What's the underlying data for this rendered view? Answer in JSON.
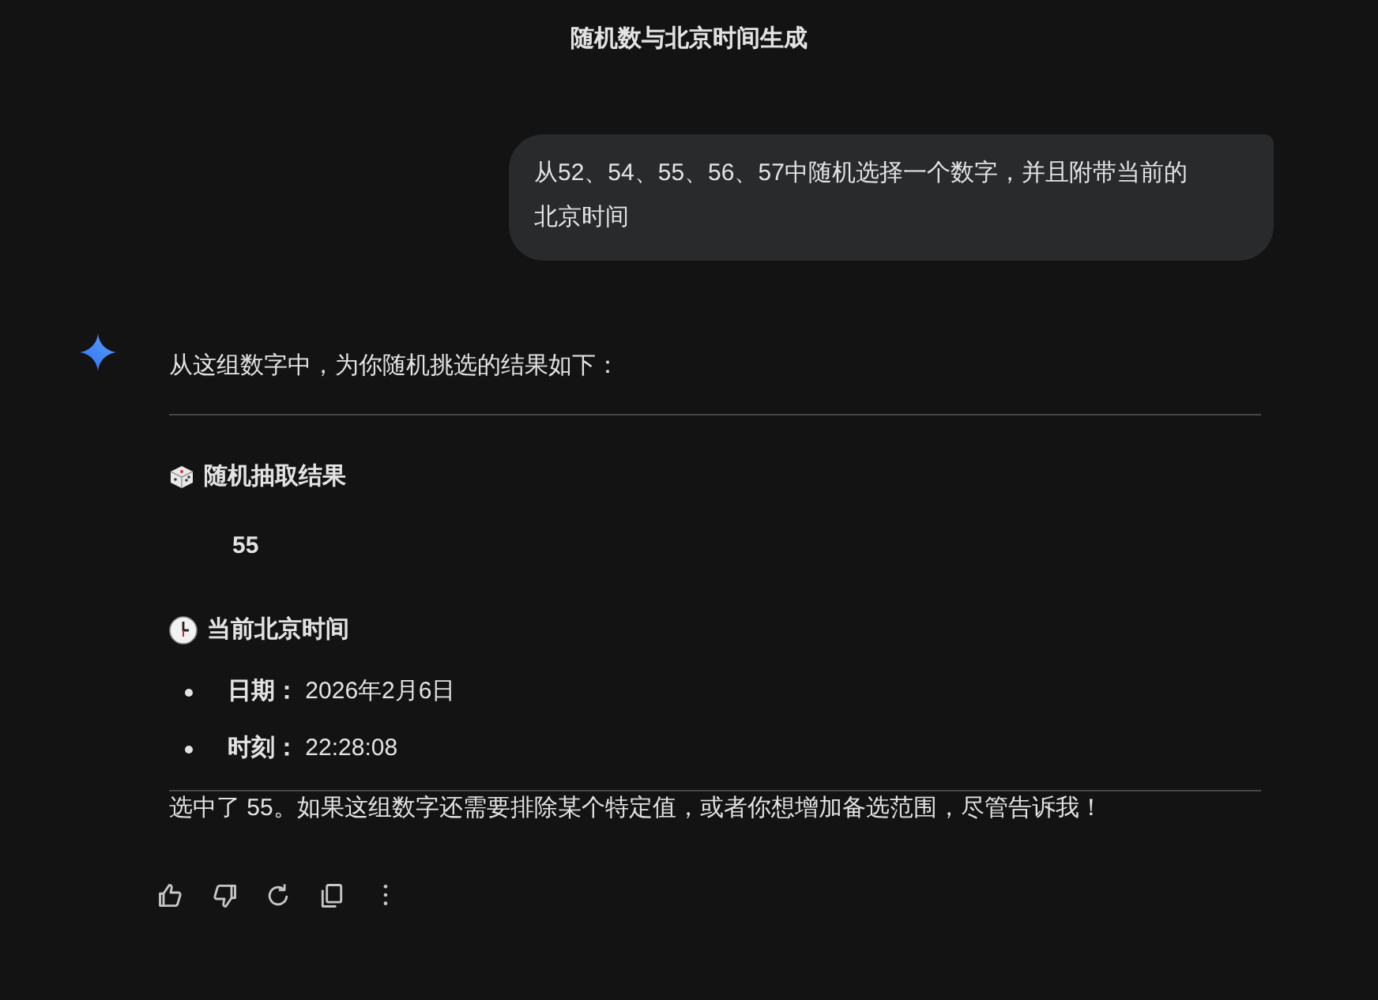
{
  "title": "随机数与北京时间生成",
  "user_message": "从52、54、55、56、57中随机选择一个数字，并且附带当前的北京时间",
  "response": {
    "intro": "从这组数字中，为你随机挑选的结果如下：",
    "sections": [
      {
        "kind": "result",
        "heading": "随机抽取结果",
        "value": "55"
      },
      {
        "kind": "list",
        "heading": "当前北京时间",
        "items": [
          "**日期：** 2026年2月6日",
          "**时刻：** 22:28:08"
        ]
      }
    ],
    "closing": "选中了 55。如果这组数字还需要排除某个特定值，或者你想增加备选范围，尽管告诉我！"
  },
  "actions": [
    {
      "kind": "like"
    },
    {
      "kind": "dislike"
    },
    {
      "kind": "regenerate"
    },
    {
      "kind": "copy"
    },
    {
      "kind": "more"
    }
  ]
}
